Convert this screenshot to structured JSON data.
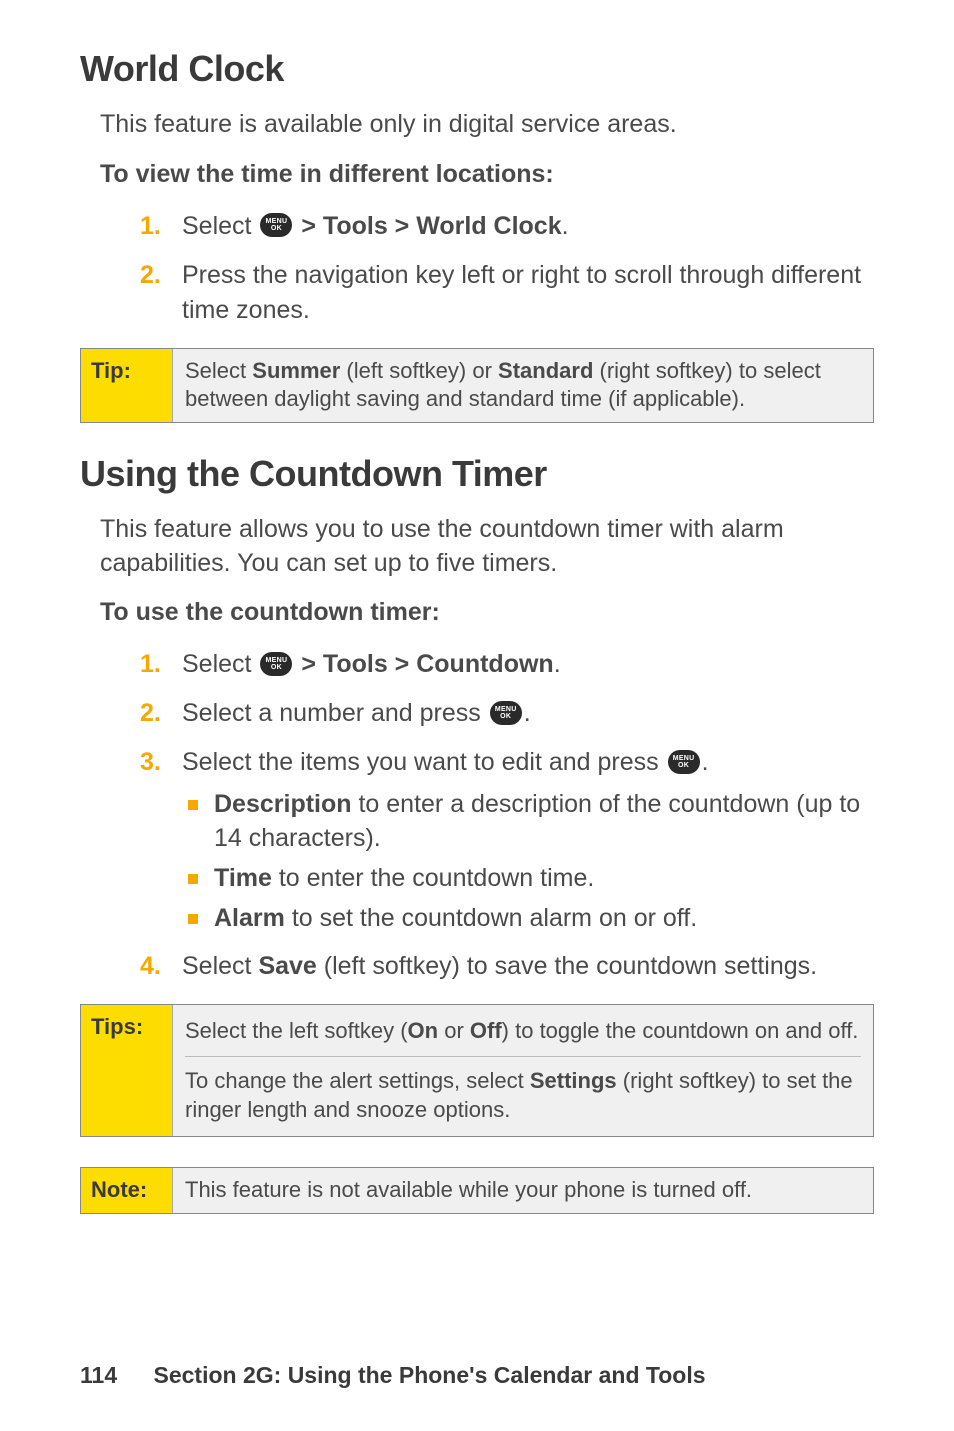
{
  "section1": {
    "heading": "World Clock",
    "intro": "This feature is available only in digital service areas.",
    "subhead": "To view the time in different locations:",
    "steps": [
      {
        "num": "1.",
        "pre": "Select ",
        "post": " > Tools > World Clock",
        "end": "."
      },
      {
        "num": "2.",
        "text": "Press the navigation key left or right to scroll through different time zones."
      }
    ],
    "tip": {
      "label": "Tip:",
      "pre": "Select ",
      "b1": "Summer",
      "mid1": " (left softkey) or ",
      "b2": "Standard",
      "post": " (right softkey) to select between daylight saving and standard time (if applicable)."
    }
  },
  "section2": {
    "heading": "Using the Countdown Timer",
    "intro": "This feature allows you to use the countdown timer with alarm capabilities. You can set up to five timers.",
    "subhead": "To use the countdown timer:",
    "steps": [
      {
        "num": "1.",
        "pre": "Select ",
        "post": " > Tools > Countdown",
        "end": "."
      },
      {
        "num": "2.",
        "pre": "Select a number and press ",
        "end": "."
      },
      {
        "num": "3.",
        "pre": "Select the items you want to edit and press ",
        "end": ".",
        "bullets": [
          {
            "b": "Description",
            "rest": " to enter a description of the countdown (up to 14 characters)."
          },
          {
            "b": "Time",
            "rest": " to enter the countdown time."
          },
          {
            "b": "Alarm",
            "rest": " to set the countdown alarm on or off."
          }
        ]
      },
      {
        "num": "4.",
        "pre": "Select ",
        "b": "Save",
        "post": " (left softkey) to save the countdown settings."
      }
    ],
    "tips": {
      "label": "Tips:",
      "rows": [
        {
          "pre": "Select the left softkey (",
          "b1": "On",
          "mid": " or ",
          "b2": "Off",
          "post": ") to toggle the countdown on and off."
        },
        {
          "pre": "To change the alert settings, select ",
          "b1": "Settings",
          "post": " (right softkey) to set the ringer length and snooze options."
        }
      ]
    },
    "note": {
      "label": "Note:",
      "text": "This feature is not available while your phone is turned off."
    }
  },
  "icon": {
    "top": "MENU",
    "bottom": "OK"
  },
  "footer": {
    "page": "114",
    "text": "Section 2G: Using the Phone's Calendar and Tools"
  }
}
